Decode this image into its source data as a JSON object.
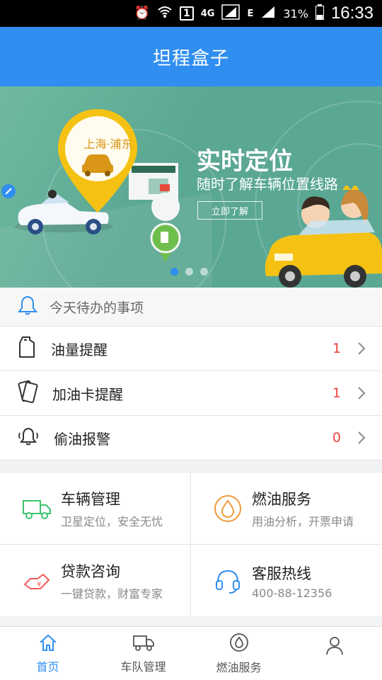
{
  "status_bar": {
    "network_label": "4G",
    "edge_label": "E",
    "sim_label": "1",
    "battery": "31%",
    "time": "16:33"
  },
  "app_bar": {
    "title": "坦程盒子"
  },
  "banner": {
    "pin_location": "上海·浦东",
    "heading": "实时定位",
    "subheading": "随时了解车辆位置线路",
    "button_label": "立即了解",
    "page_count": 3,
    "active_page": 1
  },
  "todo": {
    "header": "今天待办的事项",
    "items": [
      {
        "label": "油量提醒",
        "count": "1",
        "icon": "oil-can-icon"
      },
      {
        "label": "加油卡提醒",
        "count": "1",
        "icon": "fuel-card-icon"
      },
      {
        "label": "偷油报警",
        "count": "0",
        "icon": "alarm-bell-icon"
      }
    ]
  },
  "services": [
    {
      "name": "车辆管理",
      "desc": "卫星定位，安全无忧",
      "icon": "truck-icon",
      "color": "#3cc36f"
    },
    {
      "name": "燃油服务",
      "desc": "用油分析，开票申请",
      "icon": "fuel-drop-icon",
      "color": "#f29a38"
    },
    {
      "name": "贷款咨询",
      "desc": "一键贷款，财富专家",
      "icon": "loan-hand-icon",
      "color": "#ef5a5a"
    },
    {
      "name": "客服热线",
      "desc": "400-88-12356",
      "icon": "headset-icon",
      "color": "#2f8ef0"
    }
  ],
  "tabs": [
    {
      "label": "首页",
      "icon": "home-icon",
      "active": true
    },
    {
      "label": "车队管理",
      "icon": "truck-tab-icon",
      "active": false
    },
    {
      "label": "燃油服务",
      "icon": "drop-tab-icon",
      "active": false
    },
    {
      "label": "",
      "icon": "profile-icon",
      "active": false
    }
  ],
  "colors": {
    "primary": "#2f8ef0",
    "count_red": "#e8423e",
    "banner_green": "#5aa792"
  }
}
